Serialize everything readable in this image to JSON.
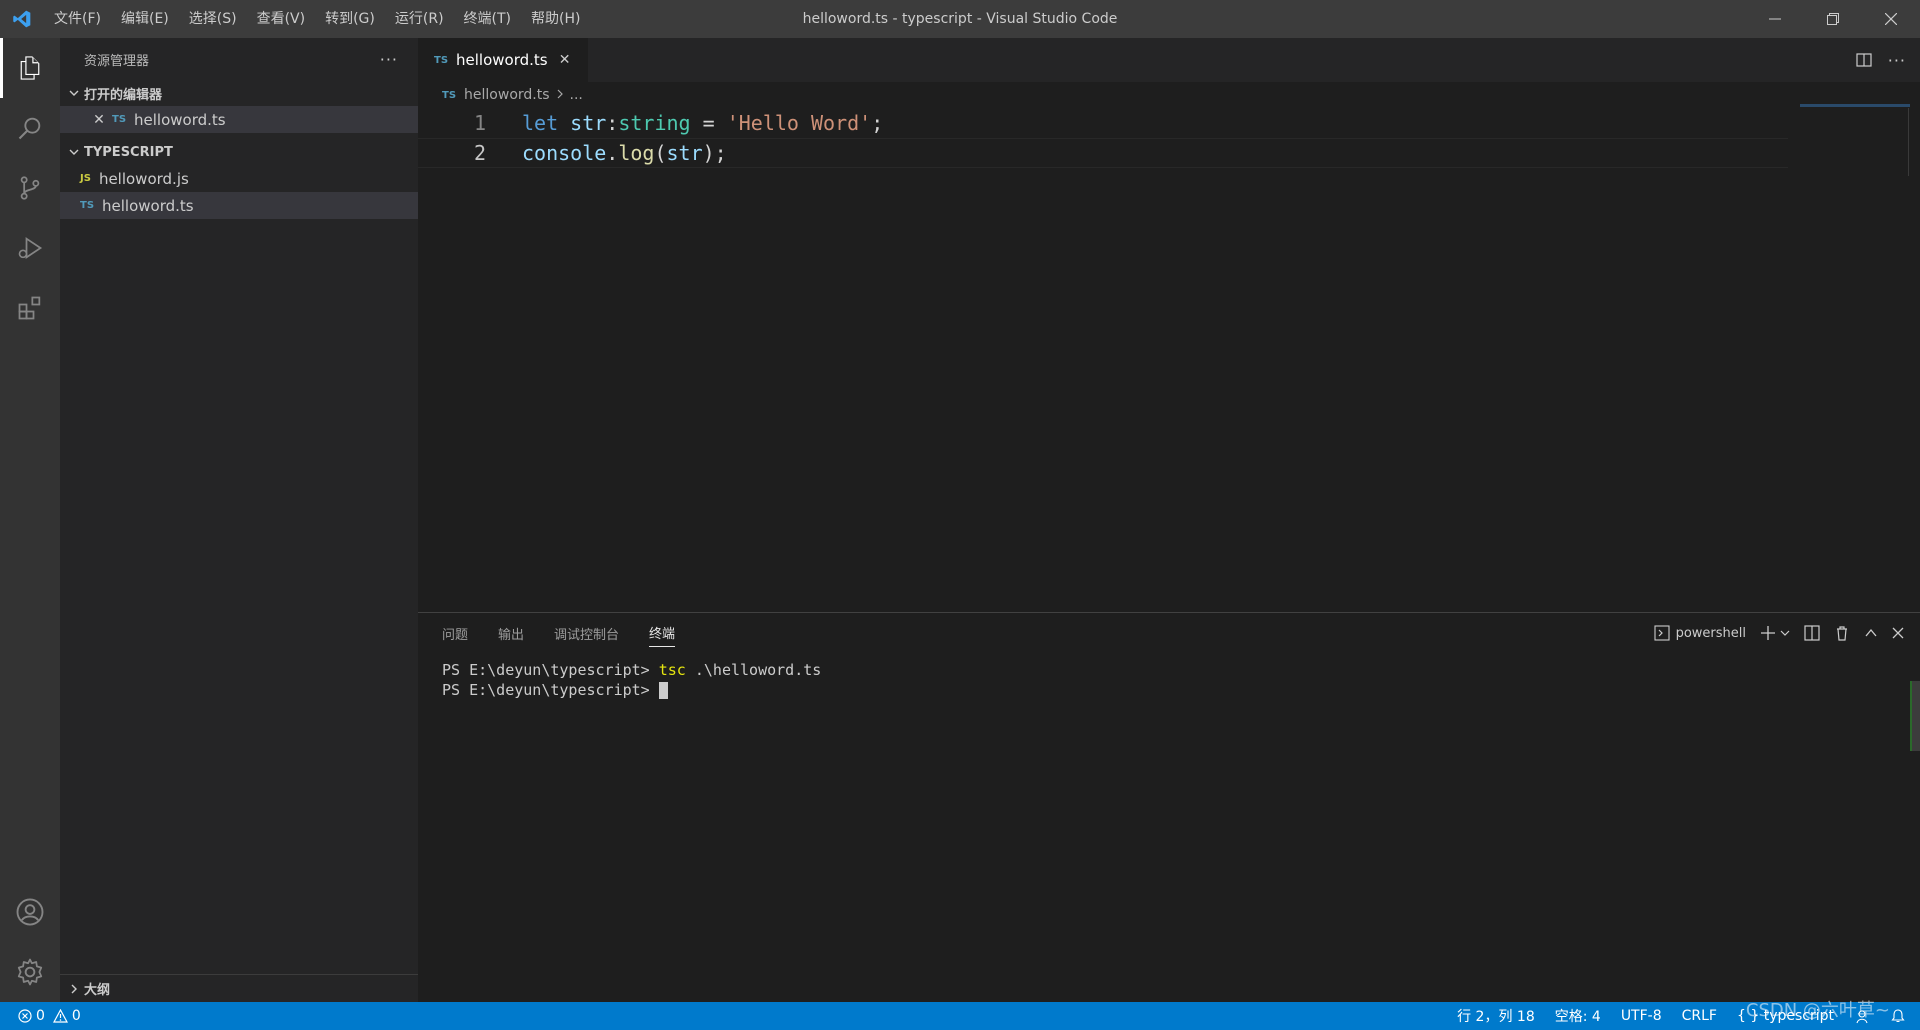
{
  "window": {
    "title": "helloword.ts - typescript - Visual Studio Code",
    "menu": [
      "文件(F)",
      "编辑(E)",
      "选择(S)",
      "查看(V)",
      "转到(G)",
      "运行(R)",
      "终端(T)",
      "帮助(H)"
    ]
  },
  "activitybar": {
    "items": [
      "files-icon",
      "search-icon",
      "source-control-icon",
      "run-debug-icon",
      "extensions-icon"
    ],
    "bottom": [
      "account-icon",
      "gear-icon"
    ]
  },
  "sidebar": {
    "title": "资源管理器",
    "more": "···",
    "open_editors": {
      "label": "打开的编辑器",
      "files": [
        {
          "badge": "TS",
          "name": "helloword.ts"
        }
      ]
    },
    "folder": {
      "label": "TYPESCRIPT",
      "files": [
        {
          "badge": "JS",
          "name": "helloword.js"
        },
        {
          "badge": "TS",
          "name": "helloword.ts"
        }
      ]
    },
    "outline_label": "大纲"
  },
  "editor": {
    "tab": {
      "badge": "TS",
      "name": "helloword.ts"
    },
    "breadcrumb": {
      "badge": "TS",
      "file": "helloword.ts",
      "rest": "..."
    },
    "lines": [
      {
        "num": "1",
        "tokens": [
          {
            "t": "let",
            "c": "kw"
          },
          {
            "t": " ",
            "c": "plain"
          },
          {
            "t": "str",
            "c": "var"
          },
          {
            "t": ":",
            "c": "plain"
          },
          {
            "t": "string",
            "c": "type"
          },
          {
            "t": " = ",
            "c": "plain"
          },
          {
            "t": "'Hello Word'",
            "c": "str"
          },
          {
            "t": ";",
            "c": "plain"
          }
        ]
      },
      {
        "num": "2",
        "tokens": [
          {
            "t": "console",
            "c": "var"
          },
          {
            "t": ".",
            "c": "plain"
          },
          {
            "t": "log",
            "c": "fn"
          },
          {
            "t": "(",
            "c": "plain"
          },
          {
            "t": "str",
            "c": "var"
          },
          {
            "t": ");",
            "c": "plain"
          }
        ]
      }
    ]
  },
  "panel": {
    "tabs": [
      "问题",
      "输出",
      "调试控制台",
      "终端"
    ],
    "active_tab": "终端",
    "shell": "powershell",
    "terminal": {
      "prompt": "PS E:\\deyun\\typescript> ",
      "command": "tsc",
      "args": " .\\helloword.ts",
      "prompt2": "PS E:\\deyun\\typescript> "
    }
  },
  "statusbar": {
    "errors": "0",
    "warnings": "0",
    "position": "行 2，列 18",
    "spaces": "空格: 4",
    "encoding": "UTF-8",
    "eol": "CRLF",
    "language_braces": "{ }",
    "language": "typescript"
  },
  "watermark": "CSDN @六叶草~",
  "colors": {
    "statusbar": "#007acc",
    "titlebar": "#3c3c3c",
    "sidebar": "#252526",
    "editor": "#1e1e1e"
  }
}
